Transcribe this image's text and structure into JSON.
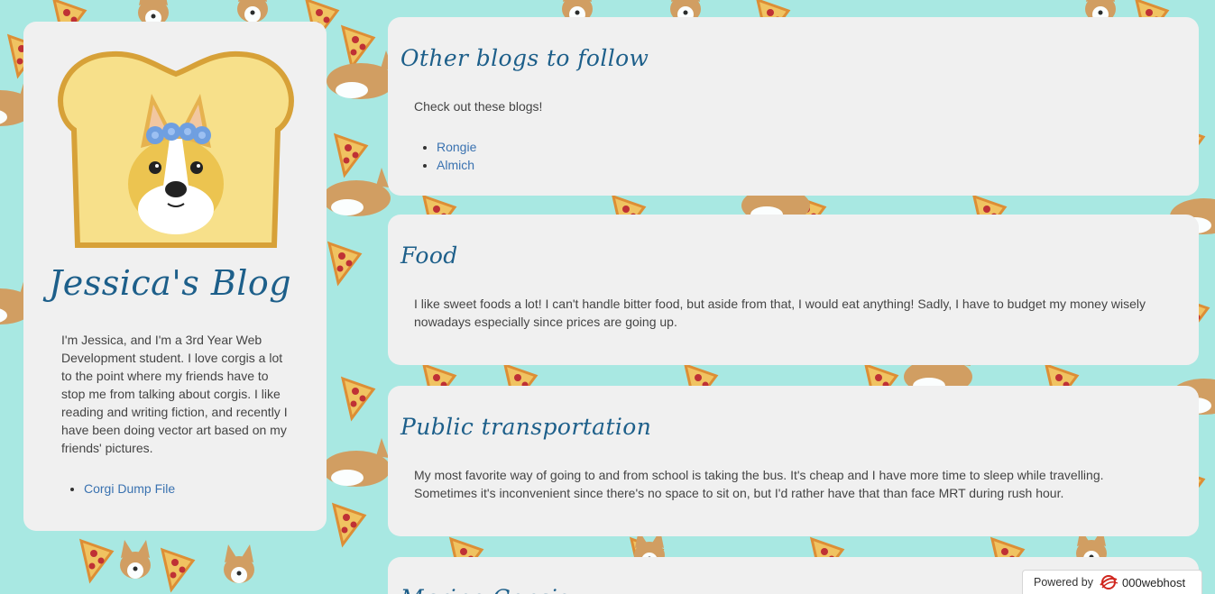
{
  "sidebar": {
    "title": "Jessica's Blog",
    "bio": "I'm Jessica, and I'm a 3rd Year Web Development student. I love corgis a lot to the point where my friends have to stop me from talking about corgis. I like reading and writing fiction, and recently I have been doing vector art based on my friends' pictures.",
    "links": [
      "Corgi Dump File"
    ]
  },
  "posts": [
    {
      "title": "Other blogs to follow",
      "body": "Check out these blogs!",
      "links": [
        "Rongie",
        "Almich"
      ]
    },
    {
      "title": "Food",
      "body": "I like sweet foods a lot! I can't handle bitter food, but aside from that, I would eat anything! Sadly, I have to budget my money wisely nowadays especially since prices are going up."
    },
    {
      "title": "Public transportation",
      "body": "My most favorite way of going to and from school is taking the bus. It's cheap and I have more time to sleep while travelling. Sometimes it's inconvenient since there's no space to sit on, but I'd rather have that than face MRT during rush hour."
    },
    {
      "title": "Marine Corgis"
    }
  ],
  "badge": {
    "powered_by": "Powered by",
    "brand": "000webhost"
  },
  "colors": {
    "background": "#a8e8e2",
    "card": "#f0f0f0",
    "heading": "#1d5f8a",
    "link": "#3a72b0"
  }
}
